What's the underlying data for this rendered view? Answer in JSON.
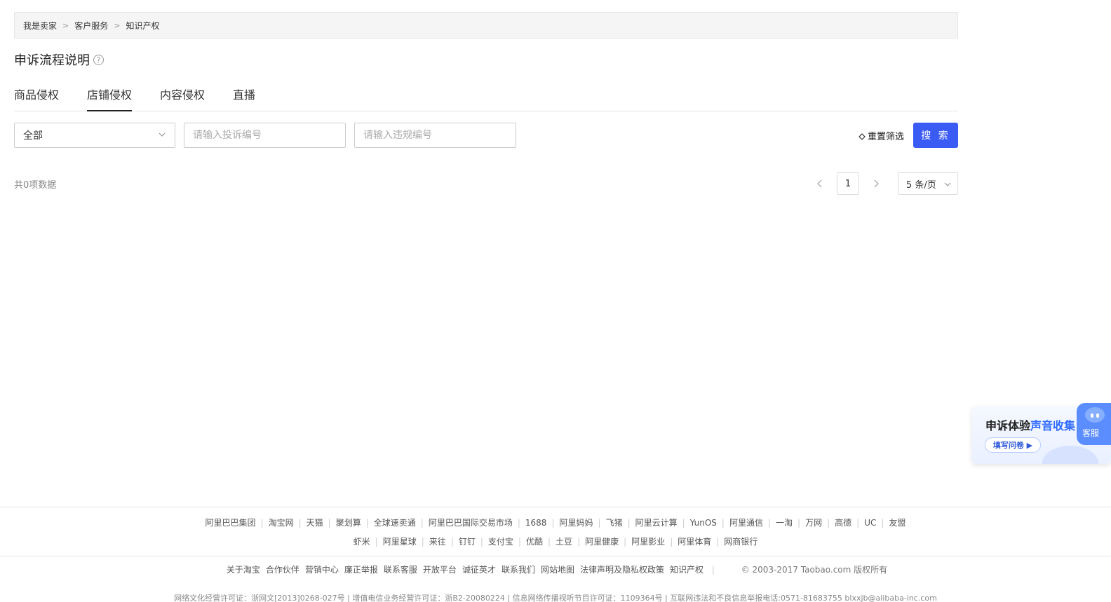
{
  "breadcrumb": [
    "我是卖家",
    "客户服务",
    "知识产权"
  ],
  "page_title": "申诉流程说明",
  "help_glyph": "?",
  "tabs": [
    "商品侵权",
    "店铺侵权",
    "内容侵权",
    "直播"
  ],
  "active_tab": "店铺侵权",
  "filters": {
    "select_value": "全部",
    "complaint_placeholder": "请输入投诉编号",
    "violation_placeholder": "请输入违规编号",
    "reset_label": "重置筛选",
    "search_label": "搜 索"
  },
  "results": {
    "total_text": "共0项数据",
    "current_page": "1",
    "page_size": "5 条/页"
  },
  "promo": {
    "title_prefix": "申诉体验",
    "title_highlight": "声音收集",
    "button_label": "填写问卷 ▶",
    "badge_label": "客服"
  },
  "footer": {
    "row1": [
      "阿里巴巴集团",
      "淘宝网",
      "天猫",
      "聚划算",
      "全球速卖通",
      "阿里巴巴国际交易市场",
      "1688",
      "阿里妈妈",
      "飞猪",
      "阿里云计算",
      "YunOS",
      "阿里通信",
      "一淘",
      "万网",
      "高德",
      "UC",
      "友盟"
    ],
    "row2": [
      "虾米",
      "阿里星球",
      "来往",
      "钉钉",
      "支付宝",
      "优酷",
      "土豆",
      "阿里健康",
      "阿里影业",
      "阿里体育",
      "网商银行"
    ],
    "about": [
      "关于淘宝",
      "合作伙伴",
      "营销中心",
      "廉正举报",
      "联系客服",
      "开放平台",
      "诚征英才",
      "联系我们",
      "网站地图",
      "法律声明及隐私权政策",
      "知识产权"
    ],
    "copyright": "© 2003-2017 Taobao.com 版权所有",
    "license_line": "网络文化经营许可证：浙网文[2013]0268-027号 | 增值电信业务经营许可证：浙B2-20080224 | 信息网络传播视听节目许可证：1109364号 | 互联网违法和不良信息举报电话:0571-81683755 blxxjb@alibaba-inc.com"
  },
  "colors": {
    "primary": "#3b5bf5",
    "promo_highlight": "#2f6bff"
  }
}
